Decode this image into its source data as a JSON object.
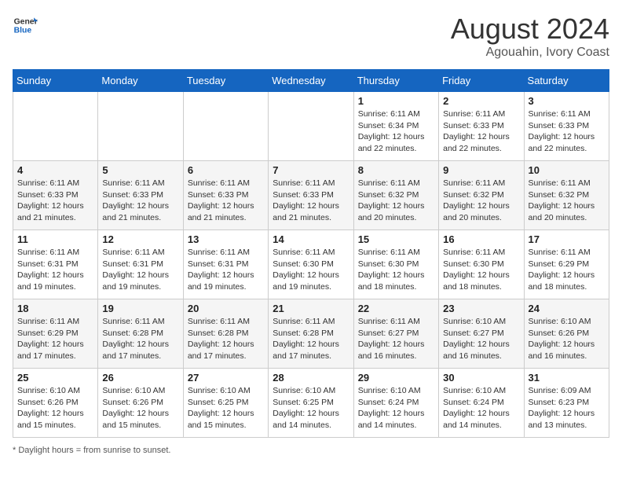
{
  "header": {
    "logo_line1": "General",
    "logo_line2": "Blue",
    "title": "August 2024",
    "subtitle": "Agouahin, Ivory Coast"
  },
  "days_of_week": [
    "Sunday",
    "Monday",
    "Tuesday",
    "Wednesday",
    "Thursday",
    "Friday",
    "Saturday"
  ],
  "weeks": [
    [
      {
        "day": "",
        "info": ""
      },
      {
        "day": "",
        "info": ""
      },
      {
        "day": "",
        "info": ""
      },
      {
        "day": "",
        "info": ""
      },
      {
        "day": "1",
        "info": "Sunrise: 6:11 AM\nSunset: 6:34 PM\nDaylight: 12 hours\nand 22 minutes."
      },
      {
        "day": "2",
        "info": "Sunrise: 6:11 AM\nSunset: 6:33 PM\nDaylight: 12 hours\nand 22 minutes."
      },
      {
        "day": "3",
        "info": "Sunrise: 6:11 AM\nSunset: 6:33 PM\nDaylight: 12 hours\nand 22 minutes."
      }
    ],
    [
      {
        "day": "4",
        "info": "Sunrise: 6:11 AM\nSunset: 6:33 PM\nDaylight: 12 hours\nand 21 minutes."
      },
      {
        "day": "5",
        "info": "Sunrise: 6:11 AM\nSunset: 6:33 PM\nDaylight: 12 hours\nand 21 minutes."
      },
      {
        "day": "6",
        "info": "Sunrise: 6:11 AM\nSunset: 6:33 PM\nDaylight: 12 hours\nand 21 minutes."
      },
      {
        "day": "7",
        "info": "Sunrise: 6:11 AM\nSunset: 6:33 PM\nDaylight: 12 hours\nand 21 minutes."
      },
      {
        "day": "8",
        "info": "Sunrise: 6:11 AM\nSunset: 6:32 PM\nDaylight: 12 hours\nand 20 minutes."
      },
      {
        "day": "9",
        "info": "Sunrise: 6:11 AM\nSunset: 6:32 PM\nDaylight: 12 hours\nand 20 minutes."
      },
      {
        "day": "10",
        "info": "Sunrise: 6:11 AM\nSunset: 6:32 PM\nDaylight: 12 hours\nand 20 minutes."
      }
    ],
    [
      {
        "day": "11",
        "info": "Sunrise: 6:11 AM\nSunset: 6:31 PM\nDaylight: 12 hours\nand 19 minutes."
      },
      {
        "day": "12",
        "info": "Sunrise: 6:11 AM\nSunset: 6:31 PM\nDaylight: 12 hours\nand 19 minutes."
      },
      {
        "day": "13",
        "info": "Sunrise: 6:11 AM\nSunset: 6:31 PM\nDaylight: 12 hours\nand 19 minutes."
      },
      {
        "day": "14",
        "info": "Sunrise: 6:11 AM\nSunset: 6:30 PM\nDaylight: 12 hours\nand 19 minutes."
      },
      {
        "day": "15",
        "info": "Sunrise: 6:11 AM\nSunset: 6:30 PM\nDaylight: 12 hours\nand 18 minutes."
      },
      {
        "day": "16",
        "info": "Sunrise: 6:11 AM\nSunset: 6:30 PM\nDaylight: 12 hours\nand 18 minutes."
      },
      {
        "day": "17",
        "info": "Sunrise: 6:11 AM\nSunset: 6:29 PM\nDaylight: 12 hours\nand 18 minutes."
      }
    ],
    [
      {
        "day": "18",
        "info": "Sunrise: 6:11 AM\nSunset: 6:29 PM\nDaylight: 12 hours\nand 17 minutes."
      },
      {
        "day": "19",
        "info": "Sunrise: 6:11 AM\nSunset: 6:28 PM\nDaylight: 12 hours\nand 17 minutes."
      },
      {
        "day": "20",
        "info": "Sunrise: 6:11 AM\nSunset: 6:28 PM\nDaylight: 12 hours\nand 17 minutes."
      },
      {
        "day": "21",
        "info": "Sunrise: 6:11 AM\nSunset: 6:28 PM\nDaylight: 12 hours\nand 17 minutes."
      },
      {
        "day": "22",
        "info": "Sunrise: 6:11 AM\nSunset: 6:27 PM\nDaylight: 12 hours\nand 16 minutes."
      },
      {
        "day": "23",
        "info": "Sunrise: 6:10 AM\nSunset: 6:27 PM\nDaylight: 12 hours\nand 16 minutes."
      },
      {
        "day": "24",
        "info": "Sunrise: 6:10 AM\nSunset: 6:26 PM\nDaylight: 12 hours\nand 16 minutes."
      }
    ],
    [
      {
        "day": "25",
        "info": "Sunrise: 6:10 AM\nSunset: 6:26 PM\nDaylight: 12 hours\nand 15 minutes."
      },
      {
        "day": "26",
        "info": "Sunrise: 6:10 AM\nSunset: 6:26 PM\nDaylight: 12 hours\nand 15 minutes."
      },
      {
        "day": "27",
        "info": "Sunrise: 6:10 AM\nSunset: 6:25 PM\nDaylight: 12 hours\nand 15 minutes."
      },
      {
        "day": "28",
        "info": "Sunrise: 6:10 AM\nSunset: 6:25 PM\nDaylight: 12 hours\nand 14 minutes."
      },
      {
        "day": "29",
        "info": "Sunrise: 6:10 AM\nSunset: 6:24 PM\nDaylight: 12 hours\nand 14 minutes."
      },
      {
        "day": "30",
        "info": "Sunrise: 6:10 AM\nSunset: 6:24 PM\nDaylight: 12 hours\nand 14 minutes."
      },
      {
        "day": "31",
        "info": "Sunrise: 6:09 AM\nSunset: 6:23 PM\nDaylight: 12 hours\nand 13 minutes."
      }
    ]
  ],
  "footer": "Daylight hours"
}
